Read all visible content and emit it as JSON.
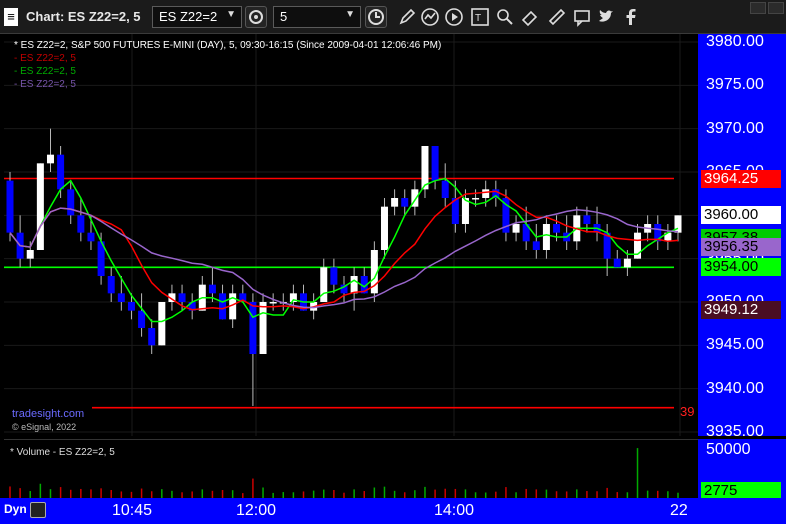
{
  "toolbar": {
    "title": "Chart: ES Z22=2, 5",
    "symbol": "ES Z22=2",
    "interval": "5",
    "icons": [
      "cycle-icon",
      "clock-icon",
      "pencil-icon",
      "chart-line-icon",
      "play-icon",
      "text-icon",
      "zoom-icon",
      "eraser-icon",
      "comment-icon",
      "twitter-icon",
      "facebook-icon"
    ]
  },
  "header": {
    "line1": "* ES Z22=2, S&P 500 FUTURES E-MINI (DAY), 5, 09:30-16:15 (Since 2009-04-01 12:06:46 PM)",
    "line2": "- ES Z22=2, 5",
    "line3": "- ES Z22=2, 5",
    "line4": "- ES Z22=2, 5"
  },
  "watermark": "tradesight.com",
  "copyright": "© eSignal, 2022",
  "red_edge_label": "39",
  "axis": {
    "ticks": [
      "3980.00",
      "3975.00",
      "3970.00",
      "3965.00",
      "3960.00",
      "3955.00",
      "3950.00",
      "3945.00",
      "3940.00",
      "3935.00"
    ],
    "tags": [
      {
        "label": "3964.25",
        "bg": "#ff0000",
        "fg": "#ffffff"
      },
      {
        "label": "3960.00",
        "bg": "#ffffff",
        "fg": "#000000"
      },
      {
        "label": "3957.38",
        "bg": "#00cc00",
        "fg": "#000000"
      },
      {
        "label": "3956.35",
        "bg": "#9966cc",
        "fg": "#000000"
      },
      {
        "label": "3954.00",
        "bg": "#00ff00",
        "fg": "#000000"
      },
      {
        "label": "3949.12",
        "bg": "#4a0e22",
        "fg": "#ffffff"
      }
    ]
  },
  "volume": {
    "title": "* Volume - ES Z22=2, 5",
    "ticks": [
      "50000"
    ],
    "tag": "2775",
    "tag_bg": "#00ff00"
  },
  "time_axis": {
    "dyn_label": "Dyn",
    "labels": [
      "10:45",
      "12:00",
      "14:00",
      "22"
    ]
  },
  "colors": {
    "up": "#ffffff",
    "down": "#0000ff",
    "red_line": "#ff0000",
    "green_line": "#00ff00",
    "purple_line": "#9966cc",
    "axis_bg": "#0000ff"
  },
  "chart_data": {
    "type": "candlestick",
    "title": "ES Z22=2, S&P 500 FUTURES E-MINI (DAY), 5",
    "ylim": [
      3935,
      3980
    ],
    "horizontal_lines": [
      {
        "value": 3964.25,
        "color": "#ff0000"
      },
      {
        "value": 3954.0,
        "color": "#00ff00"
      },
      {
        "value": 3937.8,
        "color": "#ff0000"
      }
    ],
    "candles": [
      [
        3964,
        3965,
        3957,
        3958
      ],
      [
        3958,
        3960,
        3954,
        3955
      ],
      [
        3955,
        3957,
        3954,
        3956
      ],
      [
        3956,
        3966,
        3956,
        3966
      ],
      [
        3966,
        3970,
        3965,
        3967
      ],
      [
        3967,
        3968,
        3962,
        3963
      ],
      [
        3963,
        3964,
        3959,
        3960
      ],
      [
        3960,
        3962,
        3957,
        3958
      ],
      [
        3958,
        3960,
        3956,
        3957
      ],
      [
        3957,
        3958,
        3952,
        3953
      ],
      [
        3953,
        3954,
        3950,
        3951
      ],
      [
        3951,
        3953,
        3949,
        3950
      ],
      [
        3950,
        3951,
        3948,
        3949
      ],
      [
        3949,
        3951,
        3946,
        3947
      ],
      [
        3947,
        3948,
        3944,
        3945
      ],
      [
        3945,
        3950,
        3945,
        3950
      ],
      [
        3950,
        3952,
        3949,
        3951
      ],
      [
        3951,
        3952,
        3949,
        3950
      ],
      [
        3950,
        3951,
        3948,
        3949
      ],
      [
        3949,
        3953,
        3949,
        3952
      ],
      [
        3952,
        3954,
        3950,
        3951
      ],
      [
        3951,
        3952,
        3948,
        3948
      ],
      [
        3948,
        3952,
        3947,
        3951
      ],
      [
        3951,
        3952,
        3950,
        3950
      ],
      [
        3950,
        3951,
        3938,
        3944
      ],
      [
        3944,
        3951,
        3944,
        3950
      ],
      [
        3950,
        3951,
        3949,
        3950
      ],
      [
        3950,
        3951,
        3949,
        3950
      ],
      [
        3950,
        3952,
        3949,
        3951
      ],
      [
        3951,
        3952,
        3949,
        3949
      ],
      [
        3949,
        3951,
        3948,
        3950
      ],
      [
        3950,
        3955,
        3950,
        3954
      ],
      [
        3954,
        3955,
        3951,
        3952
      ],
      [
        3952,
        3953,
        3950,
        3951
      ],
      [
        3951,
        3954,
        3949,
        3953
      ],
      [
        3953,
        3954,
        3951,
        3951
      ],
      [
        3951,
        3957,
        3950,
        3956
      ],
      [
        3956,
        3962,
        3955,
        3961
      ],
      [
        3961,
        3963,
        3960,
        3962
      ],
      [
        3962,
        3963,
        3960,
        3961
      ],
      [
        3961,
        3964,
        3960,
        3963
      ],
      [
        3963,
        3968,
        3962,
        3968
      ],
      [
        3968,
        3968,
        3963,
        3964
      ],
      [
        3964,
        3966,
        3961,
        3962
      ],
      [
        3962,
        3964,
        3958,
        3959
      ],
      [
        3959,
        3963,
        3958,
        3962
      ],
      [
        3962,
        3963,
        3961,
        3962
      ],
      [
        3962,
        3964,
        3961,
        3963
      ],
      [
        3963,
        3964,
        3961,
        3962
      ],
      [
        3962,
        3963,
        3957,
        3958
      ],
      [
        3958,
        3960,
        3957,
        3959
      ],
      [
        3959,
        3961,
        3956,
        3957
      ],
      [
        3957,
        3959,
        3955,
        3956
      ],
      [
        3956,
        3960,
        3955,
        3959
      ],
      [
        3959,
        3960,
        3957,
        3958
      ],
      [
        3958,
        3960,
        3956,
        3957
      ],
      [
        3957,
        3961,
        3956,
        3960
      ],
      [
        3960,
        3961,
        3958,
        3959
      ],
      [
        3959,
        3961,
        3957,
        3958
      ],
      [
        3958,
        3959,
        3953,
        3955
      ],
      [
        3955,
        3956,
        3954,
        3954
      ],
      [
        3954,
        3956,
        3953,
        3955
      ],
      [
        3955,
        3959,
        3955,
        3958
      ],
      [
        3958,
        3960,
        3957,
        3959
      ],
      [
        3959,
        3960,
        3956,
        3957
      ],
      [
        3957,
        3959,
        3956,
        3958
      ],
      [
        3958,
        3960,
        3957,
        3960
      ]
    ],
    "volume_ylim": [
      0,
      50000
    ]
  }
}
